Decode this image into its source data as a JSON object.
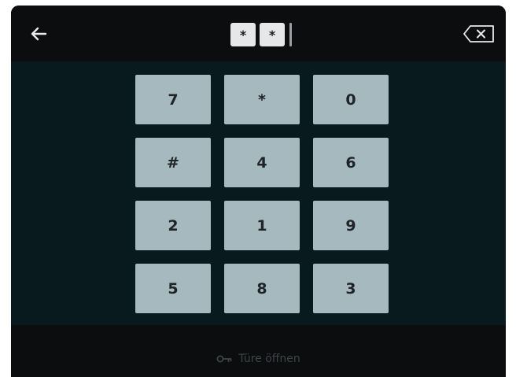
{
  "header": {
    "back_icon": "arrow-left-icon",
    "pin_chars": [
      "*",
      "*"
    ],
    "delete_icon": "backspace-icon"
  },
  "keypad": {
    "keys": [
      "7",
      "*",
      "0",
      "#",
      "4",
      "6",
      "2",
      "1",
      "9",
      "5",
      "8",
      "3"
    ]
  },
  "footer": {
    "open_door_icon": "key-icon",
    "open_door_label": "Türe öffnen"
  },
  "colors": {
    "frame": "#0b0d0e",
    "keypad_background": "#081a1e",
    "key_fill": "#a6b9be",
    "pin_fill": "#e6e7e8",
    "footer_text": "#3f4447"
  }
}
